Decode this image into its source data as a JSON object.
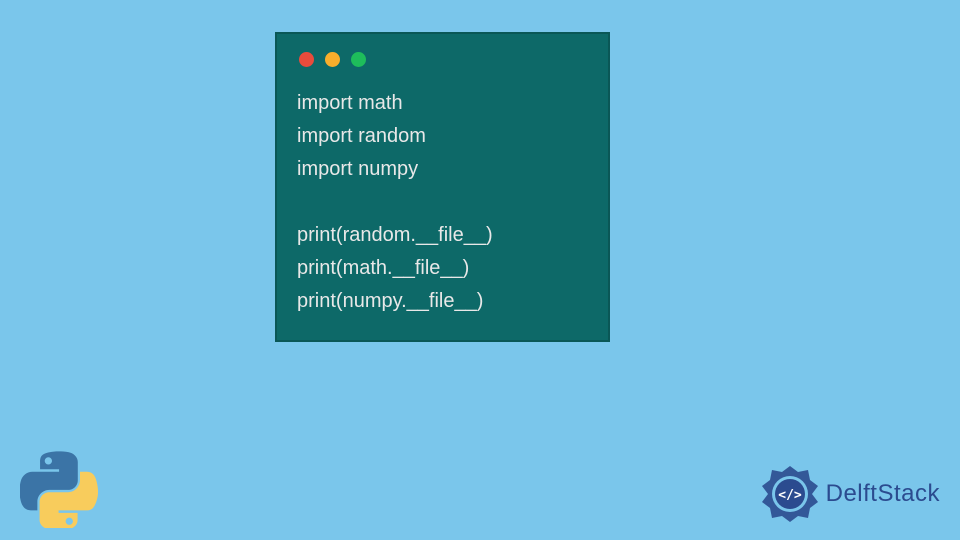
{
  "code": {
    "lines": [
      "import math",
      "import random",
      "import numpy",
      "",
      "print(random.__file__)",
      "print(math.__file__)",
      "print(numpy.__file__)"
    ]
  },
  "branding": {
    "name": "DelftStack"
  },
  "colors": {
    "background": "#7ac6eb",
    "codeWindow": "#0d6968",
    "codeText": "#e8e8e8",
    "dotRed": "#e84b3c",
    "dotYellow": "#f8ae2c",
    "dotGreen": "#1ebd5b",
    "brandBlue": "#2b4b8f"
  }
}
